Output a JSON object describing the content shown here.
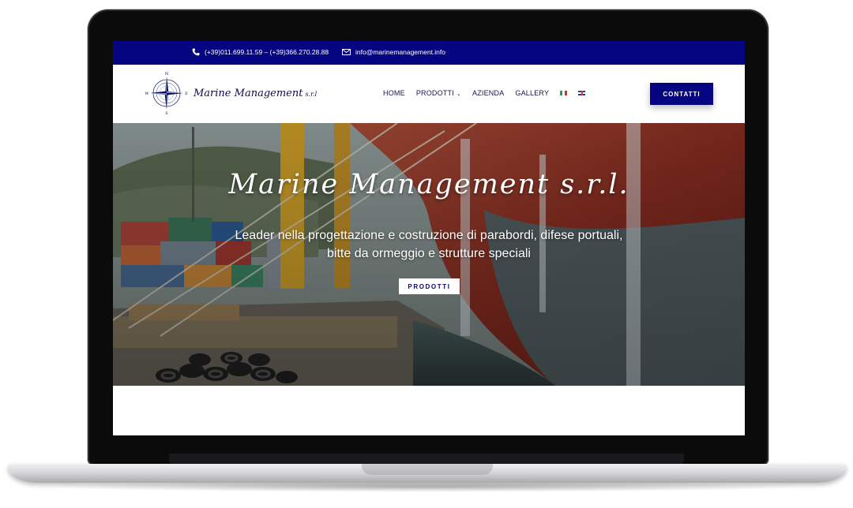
{
  "topbar": {
    "phone": "(+39)011.699.11.59 – (+39)366.270.28.88",
    "phone_icon": "phone-icon",
    "email": "info@marinemanagement.info",
    "email_icon": "mail-icon"
  },
  "logo": {
    "name": "Marine Management",
    "suffix": "s.r.l",
    "compass": {
      "n": "N",
      "s": "S",
      "e": "E",
      "w": "W"
    }
  },
  "nav": {
    "items": [
      "HOME",
      "PRODOTTI",
      "AZIENDA",
      "GALLERY"
    ],
    "languages": [
      "it-flag",
      "en-flag"
    ]
  },
  "cta": {
    "label": "CONTATTI"
  },
  "hero": {
    "title": "Marine Management s.r.l.",
    "subtitle": "Leader nella progettazione e costruzione di parabordi, difese portuali, bitte da ormeggio e strutture speciali",
    "button": "PRODOTTI"
  },
  "colors": {
    "brand": "#050582",
    "text_dark": "#131350",
    "white": "#ffffff"
  }
}
